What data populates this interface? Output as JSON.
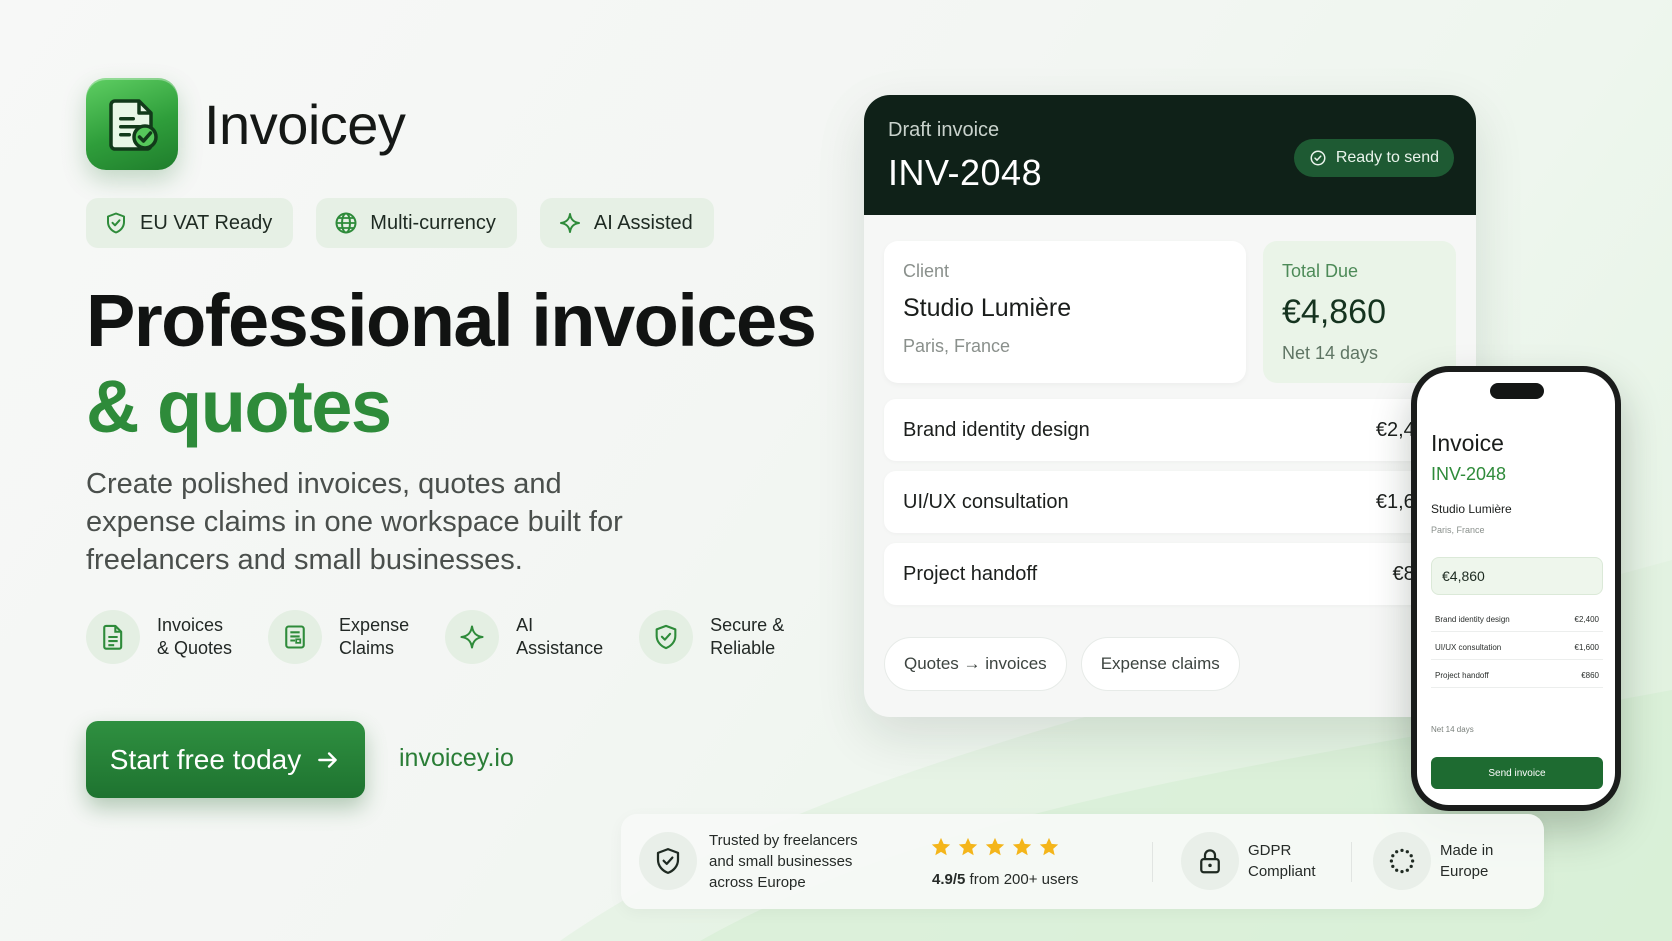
{
  "brand": {
    "name": "Invoicey",
    "accent": "#2e8b3a",
    "dark": "#0f2118"
  },
  "pills": [
    {
      "label": "EU VAT Ready",
      "icon": "shield-check-icon"
    },
    {
      "label": "Multi-currency",
      "icon": "globe-icon"
    },
    {
      "label": "AI Assisted",
      "icon": "sparkle-icon"
    }
  ],
  "headline": {
    "line1": "Professional invoices",
    "line2": "& quotes"
  },
  "subtitle": "Create polished invoices, quotes and expense claims in one workspace built for freelancers and small businesses.",
  "features": [
    {
      "line1": "Invoices",
      "line2": "& Quotes",
      "icon": "document-icon"
    },
    {
      "line1": "Expense",
      "line2": "Claims",
      "icon": "receipt-icon"
    },
    {
      "line1": "AI",
      "line2": "Assistance",
      "icon": "sparkle-icon"
    },
    {
      "line1": "Secure &",
      "line2": "Reliable",
      "icon": "shield-check-icon"
    }
  ],
  "cta": {
    "label": "Start free today",
    "site": "invoicey.io"
  },
  "invoice_card": {
    "draft_label": "Draft invoice",
    "number": "INV-2048",
    "status": "Ready to send",
    "client_label": "Client",
    "client_name": "Studio Lumière",
    "client_location": "Paris, France",
    "total_label": "Total Due",
    "total": "€4,860",
    "terms": "Net 14 days",
    "items": [
      {
        "name": "Brand identity design",
        "amount": "€2,400"
      },
      {
        "name": "UI/UX consultation",
        "amount": "€1,600"
      },
      {
        "name": "Project handoff",
        "amount": "€860"
      }
    ],
    "chips": [
      "Quotes → invoices",
      "Expense claims"
    ]
  },
  "phone": {
    "title": "Invoice",
    "number": "INV-2048",
    "client_name": "Studio Lumière",
    "client_location": "Paris, France",
    "total": "€4,860",
    "items": [
      {
        "name": "Brand identity design",
        "amount": "€2,400"
      },
      {
        "name": "UI/UX consultation",
        "amount": "€1,600"
      },
      {
        "name": "Project handoff",
        "amount": "€860"
      }
    ],
    "terms": "Net 14 days",
    "send_label": "Send invoice"
  },
  "trust": {
    "trusted": [
      "Trusted by freelancers",
      "and small businesses",
      "across Europe"
    ],
    "rating_score": "4.9/5",
    "rating_text": " from 200+ users",
    "stars": 5,
    "gdpr": [
      "GDPR",
      "Compliant"
    ],
    "europe": [
      "Made in",
      "Europe"
    ]
  }
}
